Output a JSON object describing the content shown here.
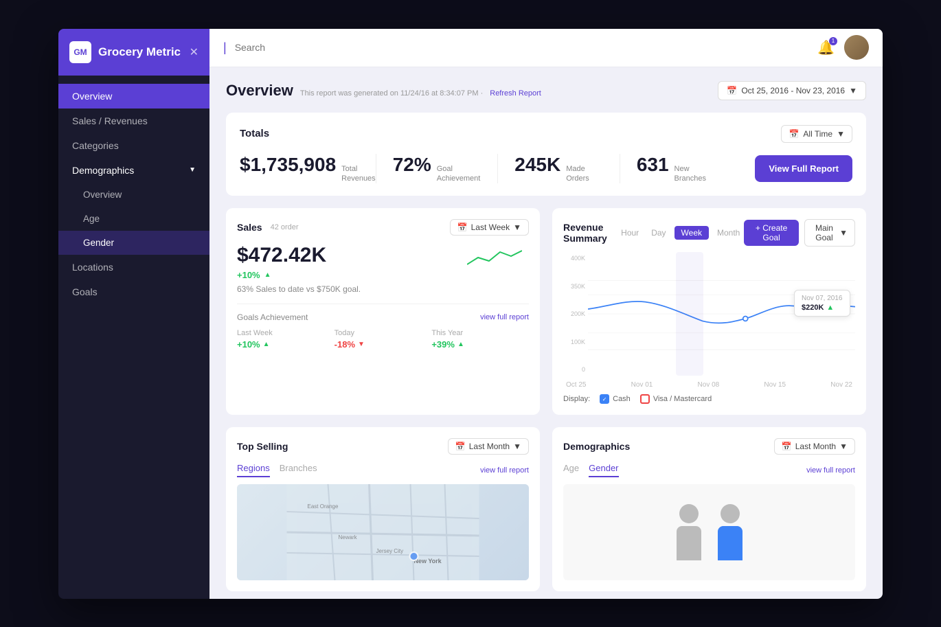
{
  "app": {
    "name": "Grocery Metric",
    "logo_text": "GM"
  },
  "topbar": {
    "search_placeholder": "Search"
  },
  "sidebar": {
    "items": [
      {
        "label": "Overview",
        "active": true,
        "sub": false
      },
      {
        "label": "Sales / Revenues",
        "active": false,
        "sub": false
      },
      {
        "label": "Categories",
        "active": false,
        "sub": false
      },
      {
        "label": "Demographics",
        "active": false,
        "sub": false,
        "has_children": true
      },
      {
        "label": "Overview",
        "active": false,
        "sub": true
      },
      {
        "label": "Age",
        "active": false,
        "sub": true
      },
      {
        "label": "Gender",
        "active": true,
        "sub": true
      },
      {
        "label": "Locations",
        "active": false,
        "sub": false
      },
      {
        "label": "Goals",
        "active": false,
        "sub": false
      }
    ]
  },
  "overview": {
    "title": "Overview",
    "report_meta": "This report was generated on 11/24/16 at 8:34:07 PM ·",
    "refresh_label": "Refresh Report",
    "date_range": "Oct 25, 2016 - Nov 23, 2016"
  },
  "totals": {
    "section_title": "Totals",
    "filter_label": "All Time",
    "metrics": [
      {
        "value": "$1,735,908",
        "label1": "Total",
        "label2": "Revenues"
      },
      {
        "value": "72%",
        "label1": "Goal",
        "label2": "Achievement"
      },
      {
        "value": "245K",
        "label1": "Made",
        "label2": "Orders"
      },
      {
        "value": "631",
        "label1": "New",
        "label2": "Branches"
      }
    ],
    "view_full_label": "View Full Report"
  },
  "sales": {
    "title": "Sales",
    "order_count": "42 order",
    "filter_label": "Last Week",
    "amount": "$472.42K",
    "trend_percent": "+10%",
    "trend_direction": "up",
    "goal_text": "63% Sales to date vs $750K goal.",
    "goals_achievement": {
      "title": "Goals Achievement",
      "view_label": "view full report",
      "periods": [
        {
          "label": "Last Week",
          "value": "+10%",
          "direction": "up"
        },
        {
          "label": "Today",
          "value": "-18%",
          "direction": "down"
        },
        {
          "label": "This Year",
          "value": "+39%",
          "direction": "up"
        }
      ]
    }
  },
  "revenue_summary": {
    "title": "Revenue Summary",
    "time_tabs": [
      "Hour",
      "Day",
      "Week",
      "Month"
    ],
    "active_tab": "Week",
    "create_goal_label": "+ Create Goal",
    "main_goal_label": "Main Goal",
    "y_labels": [
      "400K",
      "350K",
      "200K",
      "100K",
      "0"
    ],
    "x_labels": [
      "Oct 25",
      "Nov 01",
      "Nov 08",
      "Nov 15",
      "Nov 22"
    ],
    "tooltip": {
      "date": "Nov 07, 2016",
      "value": "$220K",
      "trend": "▲"
    },
    "legend": {
      "display_label": "Display:",
      "items": [
        {
          "label": "Cash",
          "checked": true,
          "color": "#3b82f6"
        },
        {
          "label": "Visa / Mastercard",
          "checked": false,
          "color": "#ef4444"
        }
      ]
    }
  },
  "top_selling": {
    "title": "Top Selling",
    "filter_label": "Last Month",
    "tabs": [
      "Regions",
      "Branches"
    ],
    "active_tab": "Regions",
    "view_label": "view full report"
  },
  "demographics": {
    "title": "Demographics",
    "filter_label": "Last Month",
    "tabs": [
      "Age",
      "Gender"
    ],
    "active_tab": "Gender",
    "view_label": "view full report"
  }
}
